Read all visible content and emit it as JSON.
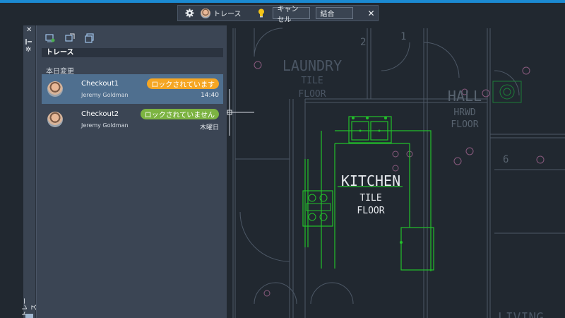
{
  "toolbar": {
    "title": "トレース",
    "cancel_label": "キャンセル",
    "merge_label": "結合"
  },
  "palette": {
    "header": "トレース",
    "section_label": "本日変更",
    "side_label": "トレース",
    "items": [
      {
        "name": "Checkout1",
        "author": "Jeremy Goldman",
        "status": "ロックされています",
        "status_color": "#f5a623",
        "time": "14:40",
        "selected": true
      },
      {
        "name": "Checkout2",
        "author": "Jeremy Goldman",
        "status": "ロックされていません",
        "status_color": "#7cb342",
        "time": "木曜日",
        "selected": false
      }
    ]
  },
  "drawing": {
    "room_numbers": [
      "2",
      "1",
      "6"
    ],
    "laundry": [
      "LAUNDRY",
      "TILE",
      "FLOOR"
    ],
    "hall": [
      "HALL",
      "HRWD",
      "FLOOR"
    ],
    "kitchen": [
      "KITCHEN",
      "TILE",
      "FLOOR"
    ],
    "living": "LIVING",
    "colors": {
      "linework": "#4d5866",
      "kitchen": "#22c02a",
      "text": "#58636f"
    }
  }
}
